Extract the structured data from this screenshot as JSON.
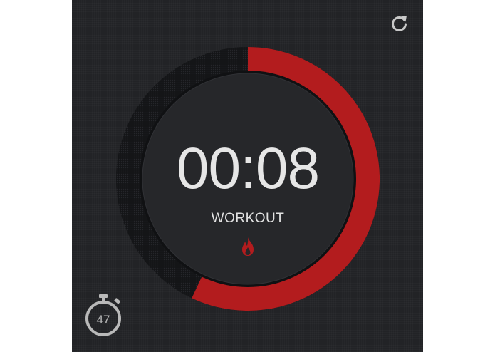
{
  "timer": {
    "time_display": "00:08",
    "phase_label": "WORKOUT",
    "progress_fraction": 0.57
  },
  "controls": {
    "reset_icon": "refresh-icon",
    "rounds_icon": "stopwatch-icon",
    "rounds_count": "47"
  },
  "colors": {
    "background": "#222326",
    "accent_red": "#b31c1e",
    "track_dark": "#141517",
    "text": "#e6e6e6",
    "icon_gray": "#b9b9b9"
  }
}
